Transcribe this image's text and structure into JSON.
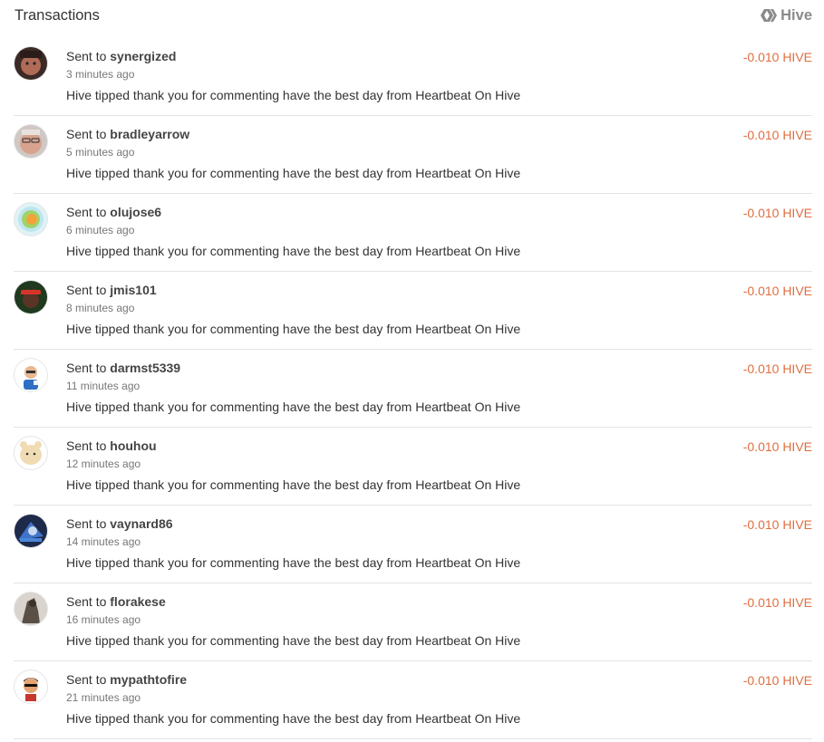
{
  "header": {
    "title": "Transactions",
    "brand_label": "Hive",
    "brand_icon": "hive-logo-icon"
  },
  "colors": {
    "amount_negative": "#e06e3f",
    "brand_gray": "#8a8a8a",
    "divider": "#e3e3e3"
  },
  "transactions": [
    {
      "prefix": "Sent to",
      "user": "synergized",
      "time": "3 minutes ago",
      "memo": "Hive tipped thank you for commenting have the best day from Heartbeat On Hive",
      "amount": "-0.010 HIVE"
    },
    {
      "prefix": "Sent to",
      "user": "bradleyarrow",
      "time": "5 minutes ago",
      "memo": "Hive tipped thank you for commenting have the best day from Heartbeat On Hive",
      "amount": "-0.010 HIVE"
    },
    {
      "prefix": "Sent to",
      "user": "olujose6",
      "time": "6 minutes ago",
      "memo": "Hive tipped thank you for commenting have the best day from Heartbeat On Hive",
      "amount": "-0.010 HIVE"
    },
    {
      "prefix": "Sent to",
      "user": "jmis101",
      "time": "8 minutes ago",
      "memo": "Hive tipped thank you for commenting have the best day from Heartbeat On Hive",
      "amount": "-0.010 HIVE"
    },
    {
      "prefix": "Sent to",
      "user": "darmst5339",
      "time": "11 minutes ago",
      "memo": "Hive tipped thank you for commenting have the best day from Heartbeat On Hive",
      "amount": "-0.010 HIVE"
    },
    {
      "prefix": "Sent to",
      "user": "houhou",
      "time": "12 minutes ago",
      "memo": "Hive tipped thank you for commenting have the best day from Heartbeat On Hive",
      "amount": "-0.010 HIVE"
    },
    {
      "prefix": "Sent to",
      "user": "vaynard86",
      "time": "14 minutes ago",
      "memo": "Hive tipped thank you for commenting have the best day from Heartbeat On Hive",
      "amount": "-0.010 HIVE"
    },
    {
      "prefix": "Sent to",
      "user": "florakese",
      "time": "16 minutes ago",
      "memo": "Hive tipped thank you for commenting have the best day from Heartbeat On Hive",
      "amount": "-0.010 HIVE"
    },
    {
      "prefix": "Sent to",
      "user": "mypathtofire",
      "time": "21 minutes ago",
      "memo": "Hive tipped thank you for commenting have the best day from Heartbeat On Hive",
      "amount": "-0.010 HIVE"
    }
  ]
}
